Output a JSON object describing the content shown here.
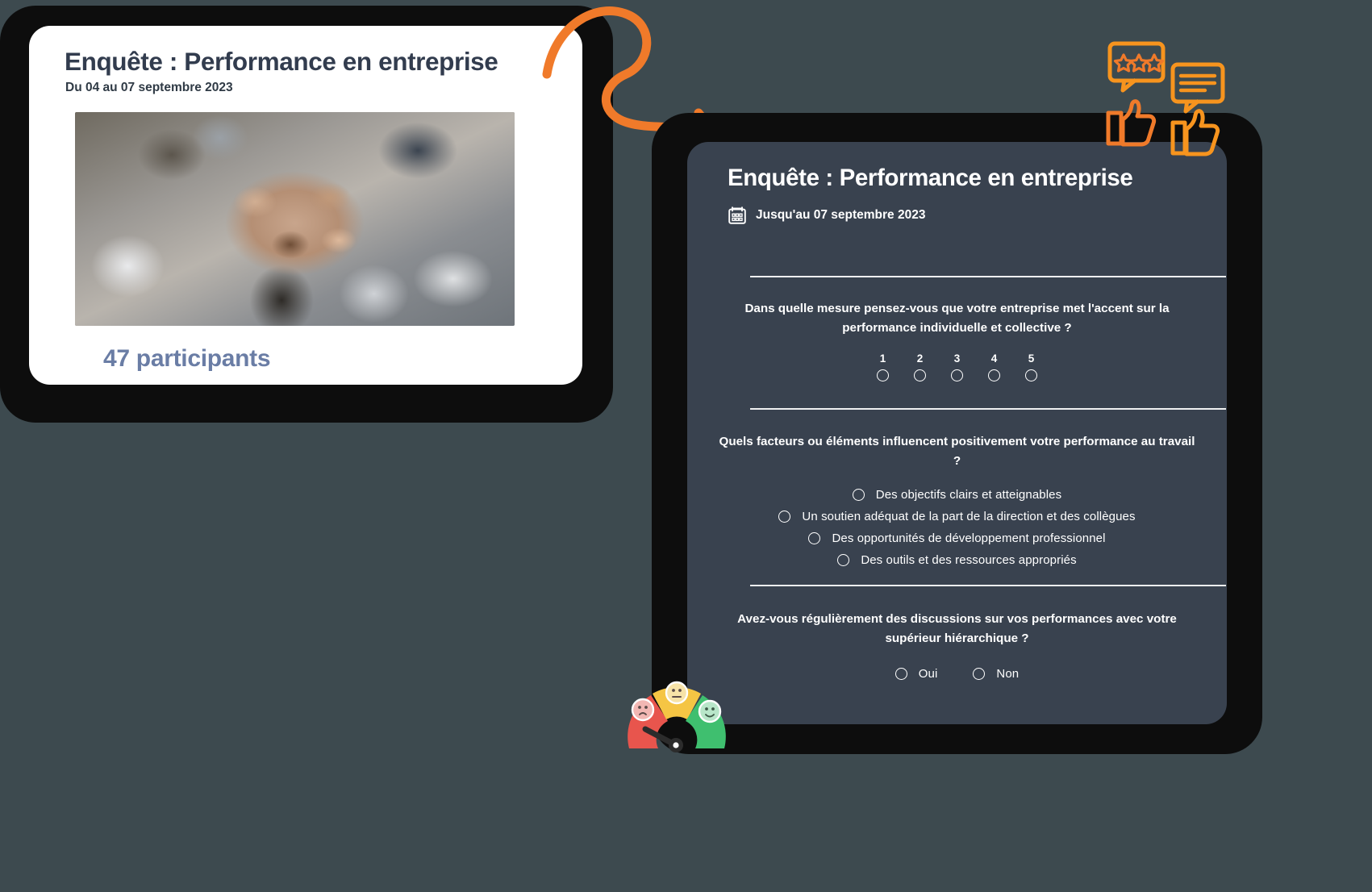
{
  "left_card": {
    "title": "Enquête : Performance en entreprise",
    "date": "Du 04 au 07 septembre 2023",
    "participants": "47 participants",
    "photo_alt": "team-hands-together-photo"
  },
  "right_tablet": {
    "title": "Enquête : Performance en entreprise",
    "date": "Jusqu'au 07 septembre 2023",
    "calendar_icon": "calendar-icon",
    "questions": [
      {
        "id": "q1",
        "text": "Dans quelle mesure pensez-vous que votre entreprise met l'accent sur la performance individuelle et collective ?",
        "type": "scale",
        "scale": [
          "1",
          "2",
          "3",
          "4",
          "5"
        ]
      },
      {
        "id": "q2",
        "text": "Quels facteurs ou éléments influencent positivement votre performance au travail ?",
        "type": "radio-list",
        "options": [
          "Des objectifs clairs et atteignables",
          "Un soutien adéquat de la part de la direction et des collègues",
          "Des opportunités de développement professionnel",
          "Des outils et des ressources appropriés"
        ]
      },
      {
        "id": "q3",
        "text": "Avez-vous régulièrement des discussions sur vos performances avec votre supérieur hiérarchique ?",
        "type": "radio-inline",
        "options": [
          "Oui",
          "Non"
        ]
      }
    ]
  },
  "decor": {
    "arrow": "curved-orange-arrow",
    "review_icon": "review-stars-thumbsup-icon",
    "gauge_icon": "satisfaction-gauge-icon"
  },
  "colors": {
    "page_background": "#3d4a4f",
    "tablet_frame": "#0d0d0d",
    "card_background": "#ffffff",
    "survey_panel": "#39424f",
    "title_dark": "#323c4e",
    "participants_blue": "#6a7da5",
    "accent_orange": "#f07a2a",
    "accent_yellow": "#f5a623",
    "gauge_red": "#e8554d",
    "gauge_green": "#3fbf6f",
    "text_white": "#ffffff"
  }
}
